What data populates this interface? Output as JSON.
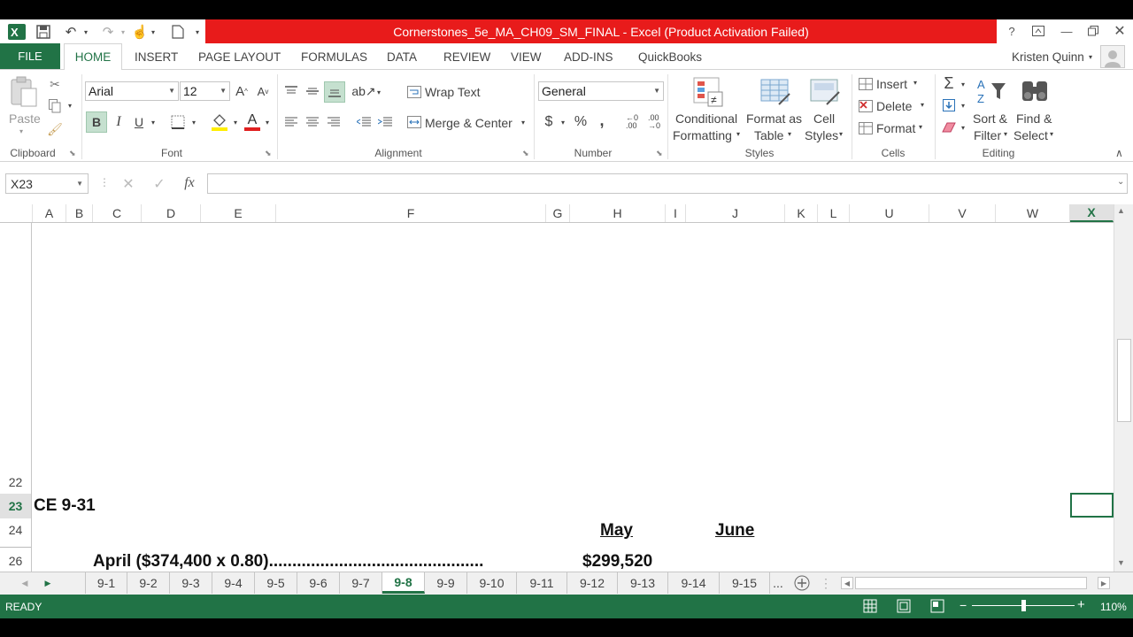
{
  "window": {
    "title": "Cornerstones_5e_MA_CH09_SM_FINAL -  Excel (Product Activation Failed)",
    "user": "Kristen Quinn"
  },
  "tabs": [
    "FILE",
    "HOME",
    "INSERT",
    "PAGE LAYOUT",
    "FORMULAS",
    "DATA",
    "REVIEW",
    "VIEW",
    "ADD-INS",
    "QuickBooks"
  ],
  "ribbon": {
    "clipboard": {
      "paste": "Paste",
      "label": "Clipboard"
    },
    "font": {
      "name": "Arial",
      "size": "12",
      "bold": "B",
      "italic": "I",
      "underline": "U",
      "label": "Font"
    },
    "alignment": {
      "wrap": "Wrap Text",
      "merge": "Merge & Center",
      "label": "Alignment"
    },
    "number": {
      "format": "General",
      "currency": "$",
      "percent": "%",
      "comma": ",",
      "label": "Number"
    },
    "styles": {
      "conditional_1": "Conditional",
      "conditional_2": "Formatting",
      "format_table_1": "Format as",
      "format_table_2": "Table",
      "cell_styles_1": "Cell",
      "cell_styles_2": "Styles",
      "label": "Styles"
    },
    "cells": {
      "insert": "Insert",
      "delete": "Delete",
      "format": "Format",
      "label": "Cells"
    },
    "editing": {
      "sort_1": "Sort &",
      "sort_2": "Filter",
      "find_1": "Find &",
      "find_2": "Select",
      "label": "Editing"
    }
  },
  "formula_bar": {
    "name_box": "X23",
    "fx": "fx",
    "value": ""
  },
  "columns": [
    "A",
    "B",
    "C",
    "D",
    "E",
    "F",
    "G",
    "H",
    "I",
    "J",
    "K",
    "L",
    "U",
    "V",
    "W",
    "X"
  ],
  "rows": [
    "22",
    "23",
    "24",
    "26"
  ],
  "cells": {
    "a23": "CE 9-31",
    "h24": "May",
    "j24": "June",
    "c26": "April ($374,400 x 0.80)..............................................",
    "h26": "$299,520"
  },
  "sheets": [
    "9-1",
    "9-2",
    "9-3",
    "9-4",
    "9-5",
    "9-6",
    "9-7",
    "9-8",
    "9-9",
    "9-10",
    "9-11",
    "9-12",
    "9-13",
    "9-14",
    "9-15"
  ],
  "active_sheet": "9-8",
  "sheets_more": "...",
  "status": {
    "ready": "READY",
    "zoom": "110%"
  },
  "colors": {
    "excel_green": "#217346",
    "title_red": "#e81b1b"
  }
}
